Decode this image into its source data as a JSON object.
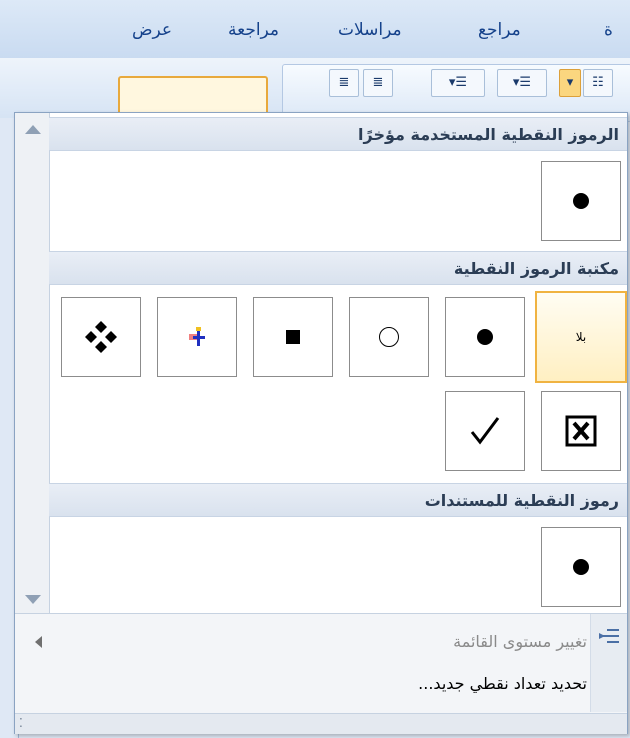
{
  "ribbon": {
    "tabs": [
      {
        "label": "عرض"
      },
      {
        "label": "مراجعة"
      },
      {
        "label": "مراسلات"
      },
      {
        "label": "مراجع"
      },
      {
        "label": "ة"
      }
    ]
  },
  "panel": {
    "recent": {
      "heading": "الرموز النقطية المستخدمة مؤخرًا"
    },
    "library": {
      "heading": "مكتبة الرموز النقطية",
      "none_label": "بلا",
      "symbols": [
        "checkmark-bullet",
        "x-box-bullet",
        "diamond-cluster-bullet",
        "colored-arrow-bullet",
        "filled-square-bullet",
        "hollow-circle-bullet",
        "filled-circle-bullet"
      ]
    },
    "document": {
      "heading": "رموز النقطية للمستندات"
    },
    "menu": {
      "change_level": "تغيير مستوى القائمة",
      "define_new": "تحديد تعداد نقطي جديد..."
    }
  },
  "colors": {
    "accent": "#f0b341",
    "heading_text": "#2b3d55",
    "ribbon_text": "#15428b"
  }
}
